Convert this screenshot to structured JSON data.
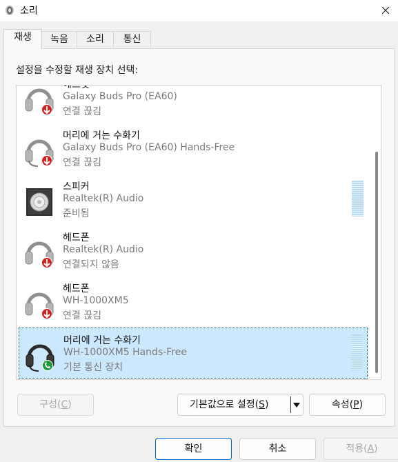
{
  "window": {
    "title": "소리",
    "app_icon": "speaker-app-icon",
    "close_icon": "close-icon"
  },
  "tabs": [
    {
      "label": "재생",
      "active": true
    },
    {
      "label": "녹음",
      "active": false
    },
    {
      "label": "소리",
      "active": false
    },
    {
      "label": "통신",
      "active": false
    }
  ],
  "instruction": "설정을 수정할 재생 장치 선택:",
  "devices": [
    {
      "name": "헤드셋",
      "sub": "Galaxy Buds Pro (EA60)",
      "status": "연결 끊김",
      "icon": "headphones-disconnected-icon"
    },
    {
      "name": "머리에 거는 수화기",
      "sub": "Galaxy Buds Pro (EA60) Hands-Free",
      "status": "연결 끊김",
      "icon": "headset-disconnected-icon"
    },
    {
      "name": "스피커",
      "sub": "Realtek(R) Audio",
      "status": "준비됨",
      "icon": "speaker-icon"
    },
    {
      "name": "헤드폰",
      "sub": "Realtek(R) Audio",
      "status": "연결되지 않음",
      "icon": "headphones-unplugged-icon"
    },
    {
      "name": "헤드폰",
      "sub": "WH-1000XM5",
      "status": "연결 끊김",
      "icon": "headphones-disconnected-icon"
    },
    {
      "name": "머리에 거는 수화기",
      "sub": "WH-1000XM5 Hands-Free",
      "status": "기본 통신 장치",
      "icon": "headset-default-communication-icon"
    }
  ],
  "buttons": {
    "configure": {
      "label": "구성",
      "mnemonic": "C"
    },
    "set_default": {
      "label": "기본값으로 설정",
      "mnemonic": "S"
    },
    "properties": {
      "label": "속성",
      "mnemonic": "P"
    },
    "ok": {
      "label": "확인"
    },
    "cancel": {
      "label": "취소"
    },
    "apply": {
      "label": "적용",
      "mnemonic": "A"
    }
  },
  "colors": {
    "selection": "#cce8ff",
    "meter": "#b8dcf2",
    "status_red": "#d32020",
    "status_green": "#1e9a3c",
    "primary_border": "#0067c0"
  }
}
